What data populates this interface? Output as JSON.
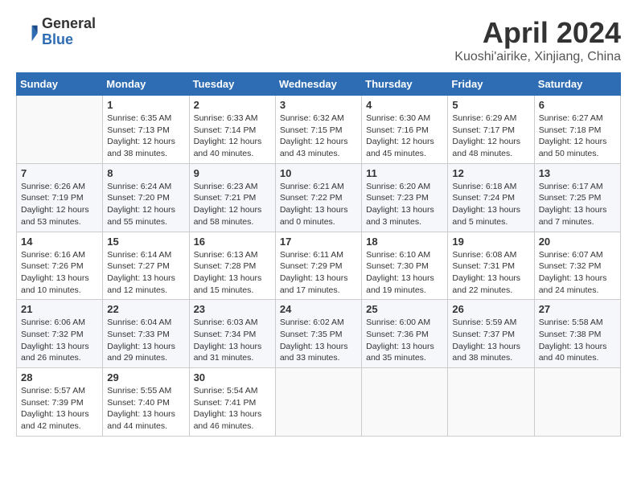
{
  "header": {
    "logo_line1": "General",
    "logo_line2": "Blue",
    "title": "April 2024",
    "subtitle": "Kuoshi'airike, Xinjiang, China"
  },
  "days_of_week": [
    "Sunday",
    "Monday",
    "Tuesday",
    "Wednesday",
    "Thursday",
    "Friday",
    "Saturday"
  ],
  "weeks": [
    [
      {
        "num": "",
        "info": ""
      },
      {
        "num": "1",
        "info": "Sunrise: 6:35 AM\nSunset: 7:13 PM\nDaylight: 12 hours\nand 38 minutes."
      },
      {
        "num": "2",
        "info": "Sunrise: 6:33 AM\nSunset: 7:14 PM\nDaylight: 12 hours\nand 40 minutes."
      },
      {
        "num": "3",
        "info": "Sunrise: 6:32 AM\nSunset: 7:15 PM\nDaylight: 12 hours\nand 43 minutes."
      },
      {
        "num": "4",
        "info": "Sunrise: 6:30 AM\nSunset: 7:16 PM\nDaylight: 12 hours\nand 45 minutes."
      },
      {
        "num": "5",
        "info": "Sunrise: 6:29 AM\nSunset: 7:17 PM\nDaylight: 12 hours\nand 48 minutes."
      },
      {
        "num": "6",
        "info": "Sunrise: 6:27 AM\nSunset: 7:18 PM\nDaylight: 12 hours\nand 50 minutes."
      }
    ],
    [
      {
        "num": "7",
        "info": "Sunrise: 6:26 AM\nSunset: 7:19 PM\nDaylight: 12 hours\nand 53 minutes."
      },
      {
        "num": "8",
        "info": "Sunrise: 6:24 AM\nSunset: 7:20 PM\nDaylight: 12 hours\nand 55 minutes."
      },
      {
        "num": "9",
        "info": "Sunrise: 6:23 AM\nSunset: 7:21 PM\nDaylight: 12 hours\nand 58 minutes."
      },
      {
        "num": "10",
        "info": "Sunrise: 6:21 AM\nSunset: 7:22 PM\nDaylight: 13 hours\nand 0 minutes."
      },
      {
        "num": "11",
        "info": "Sunrise: 6:20 AM\nSunset: 7:23 PM\nDaylight: 13 hours\nand 3 minutes."
      },
      {
        "num": "12",
        "info": "Sunrise: 6:18 AM\nSunset: 7:24 PM\nDaylight: 13 hours\nand 5 minutes."
      },
      {
        "num": "13",
        "info": "Sunrise: 6:17 AM\nSunset: 7:25 PM\nDaylight: 13 hours\nand 7 minutes."
      }
    ],
    [
      {
        "num": "14",
        "info": "Sunrise: 6:16 AM\nSunset: 7:26 PM\nDaylight: 13 hours\nand 10 minutes."
      },
      {
        "num": "15",
        "info": "Sunrise: 6:14 AM\nSunset: 7:27 PM\nDaylight: 13 hours\nand 12 minutes."
      },
      {
        "num": "16",
        "info": "Sunrise: 6:13 AM\nSunset: 7:28 PM\nDaylight: 13 hours\nand 15 minutes."
      },
      {
        "num": "17",
        "info": "Sunrise: 6:11 AM\nSunset: 7:29 PM\nDaylight: 13 hours\nand 17 minutes."
      },
      {
        "num": "18",
        "info": "Sunrise: 6:10 AM\nSunset: 7:30 PM\nDaylight: 13 hours\nand 19 minutes."
      },
      {
        "num": "19",
        "info": "Sunrise: 6:08 AM\nSunset: 7:31 PM\nDaylight: 13 hours\nand 22 minutes."
      },
      {
        "num": "20",
        "info": "Sunrise: 6:07 AM\nSunset: 7:32 PM\nDaylight: 13 hours\nand 24 minutes."
      }
    ],
    [
      {
        "num": "21",
        "info": "Sunrise: 6:06 AM\nSunset: 7:32 PM\nDaylight: 13 hours\nand 26 minutes."
      },
      {
        "num": "22",
        "info": "Sunrise: 6:04 AM\nSunset: 7:33 PM\nDaylight: 13 hours\nand 29 minutes."
      },
      {
        "num": "23",
        "info": "Sunrise: 6:03 AM\nSunset: 7:34 PM\nDaylight: 13 hours\nand 31 minutes."
      },
      {
        "num": "24",
        "info": "Sunrise: 6:02 AM\nSunset: 7:35 PM\nDaylight: 13 hours\nand 33 minutes."
      },
      {
        "num": "25",
        "info": "Sunrise: 6:00 AM\nSunset: 7:36 PM\nDaylight: 13 hours\nand 35 minutes."
      },
      {
        "num": "26",
        "info": "Sunrise: 5:59 AM\nSunset: 7:37 PM\nDaylight: 13 hours\nand 38 minutes."
      },
      {
        "num": "27",
        "info": "Sunrise: 5:58 AM\nSunset: 7:38 PM\nDaylight: 13 hours\nand 40 minutes."
      }
    ],
    [
      {
        "num": "28",
        "info": "Sunrise: 5:57 AM\nSunset: 7:39 PM\nDaylight: 13 hours\nand 42 minutes."
      },
      {
        "num": "29",
        "info": "Sunrise: 5:55 AM\nSunset: 7:40 PM\nDaylight: 13 hours\nand 44 minutes."
      },
      {
        "num": "30",
        "info": "Sunrise: 5:54 AM\nSunset: 7:41 PM\nDaylight: 13 hours\nand 46 minutes."
      },
      {
        "num": "",
        "info": ""
      },
      {
        "num": "",
        "info": ""
      },
      {
        "num": "",
        "info": ""
      },
      {
        "num": "",
        "info": ""
      }
    ]
  ]
}
